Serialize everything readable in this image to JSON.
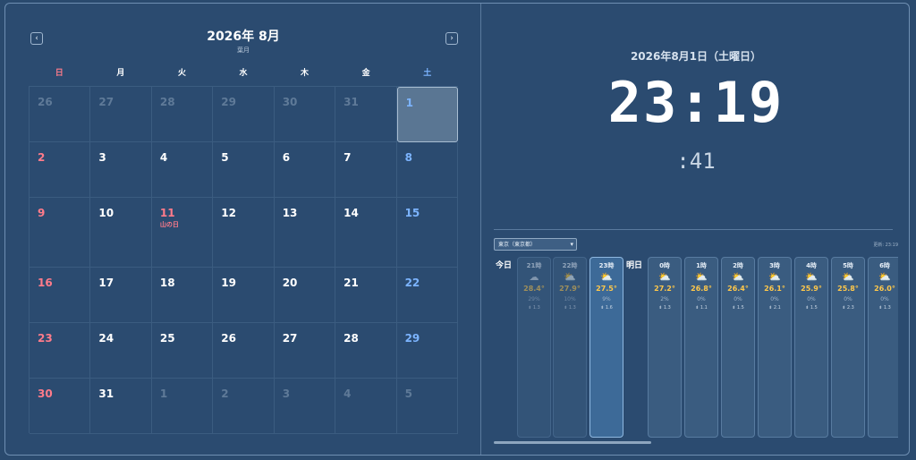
{
  "calendar": {
    "title": "2026年 8月",
    "subtitle": "葉月",
    "prev": "‹",
    "next": "›",
    "weekdays": [
      "日",
      "月",
      "火",
      "水",
      "木",
      "金",
      "土"
    ],
    "days": [
      {
        "d": "26",
        "c": "other"
      },
      {
        "d": "27",
        "c": "other"
      },
      {
        "d": "28",
        "c": "other"
      },
      {
        "d": "29",
        "c": "other"
      },
      {
        "d": "30",
        "c": "other"
      },
      {
        "d": "31",
        "c": "other"
      },
      {
        "d": "1",
        "c": "sat today"
      },
      {
        "d": "2",
        "c": "sun"
      },
      {
        "d": "3",
        "c": ""
      },
      {
        "d": "4",
        "c": ""
      },
      {
        "d": "5",
        "c": ""
      },
      {
        "d": "6",
        "c": ""
      },
      {
        "d": "7",
        "c": ""
      },
      {
        "d": "8",
        "c": "sat"
      },
      {
        "d": "9",
        "c": "sun"
      },
      {
        "d": "10",
        "c": ""
      },
      {
        "d": "11",
        "c": "holiday",
        "h": "山の日"
      },
      {
        "d": "12",
        "c": ""
      },
      {
        "d": "13",
        "c": ""
      },
      {
        "d": "14",
        "c": ""
      },
      {
        "d": "15",
        "c": "sat"
      },
      {
        "d": "16",
        "c": "sun"
      },
      {
        "d": "17",
        "c": ""
      },
      {
        "d": "18",
        "c": ""
      },
      {
        "d": "19",
        "c": ""
      },
      {
        "d": "20",
        "c": ""
      },
      {
        "d": "21",
        "c": ""
      },
      {
        "d": "22",
        "c": "sat"
      },
      {
        "d": "23",
        "c": "sun"
      },
      {
        "d": "24",
        "c": ""
      },
      {
        "d": "25",
        "c": ""
      },
      {
        "d": "26",
        "c": ""
      },
      {
        "d": "27",
        "c": ""
      },
      {
        "d": "28",
        "c": ""
      },
      {
        "d": "29",
        "c": "sat"
      },
      {
        "d": "30",
        "c": "sun"
      },
      {
        "d": "31",
        "c": ""
      },
      {
        "d": "1",
        "c": "other"
      },
      {
        "d": "2",
        "c": "other"
      },
      {
        "d": "3",
        "c": "other"
      },
      {
        "d": "4",
        "c": "other"
      },
      {
        "d": "5",
        "c": "other"
      }
    ]
  },
  "clock": {
    "date": "2026年8月1日（土曜日）",
    "time": "23:19",
    "seconds": ":41"
  },
  "weather": {
    "location": "東京（東京都）",
    "updated": "更新: 23:19",
    "today_label": "今日",
    "tomorrow_label": "明日",
    "today": [
      {
        "h": "21時",
        "icon": "cloud-icon",
        "t": "28.4°",
        "p": "29%",
        "w": "⇟ 1.3",
        "state": "past"
      },
      {
        "h": "22時",
        "icon": "cloud-sun-icon",
        "t": "27.9°",
        "p": "10%",
        "w": "⇟ 1.3",
        "state": "past"
      },
      {
        "h": "23時",
        "icon": "cloud-sun-icon",
        "t": "27.5°",
        "p": "9%",
        "w": "⇟ 1.6",
        "state": "now"
      }
    ],
    "tomorrow": [
      {
        "h": "0時",
        "icon": "cloud-sun-icon",
        "t": "27.2°",
        "p": "2%",
        "w": "⇟ 1.3"
      },
      {
        "h": "1時",
        "icon": "cloud-sun-icon",
        "t": "26.8°",
        "p": "0%",
        "w": "⇟ 1.1"
      },
      {
        "h": "2時",
        "icon": "cloud-sun-icon",
        "t": "26.4°",
        "p": "0%",
        "w": "⇟ 1.5"
      },
      {
        "h": "3時",
        "icon": "cloud-sun-icon",
        "t": "26.1°",
        "p": "0%",
        "w": "⇟ 2.1"
      },
      {
        "h": "4時",
        "icon": "cloud-sun-icon",
        "t": "25.9°",
        "p": "0%",
        "w": "⇟ 1.5"
      },
      {
        "h": "5時",
        "icon": "cloud-sun-icon",
        "t": "25.8°",
        "p": "0%",
        "w": "⇟ 2.3"
      },
      {
        "h": "6時",
        "icon": "cloud-sun-icon",
        "t": "26.0°",
        "p": "0%",
        "w": "⇟ 1.3"
      }
    ]
  }
}
